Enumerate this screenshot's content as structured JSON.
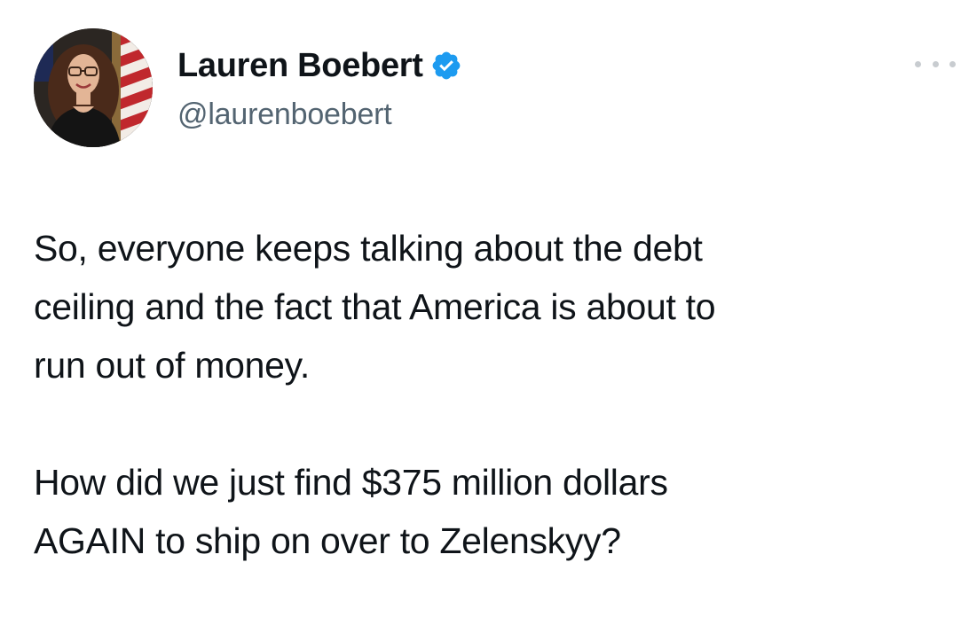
{
  "author": {
    "display_name": "Lauren Boebert",
    "handle": "@laurenboebert",
    "verified": true
  },
  "icons": {
    "verified": "verified-badge-icon",
    "more": "more-options-icon"
  },
  "colors": {
    "verified_blue": "#1d9bf0",
    "text_primary": "#0f1419",
    "text_secondary": "#536471"
  },
  "tweet": {
    "paragraphs": [
      "So, everyone keeps talking  about the debt\nceiling and the fact that America is about to\nrun out of money.",
      "How did we just find $375 million dollars\nAGAIN to ship on over to Zelenskyy?"
    ]
  }
}
